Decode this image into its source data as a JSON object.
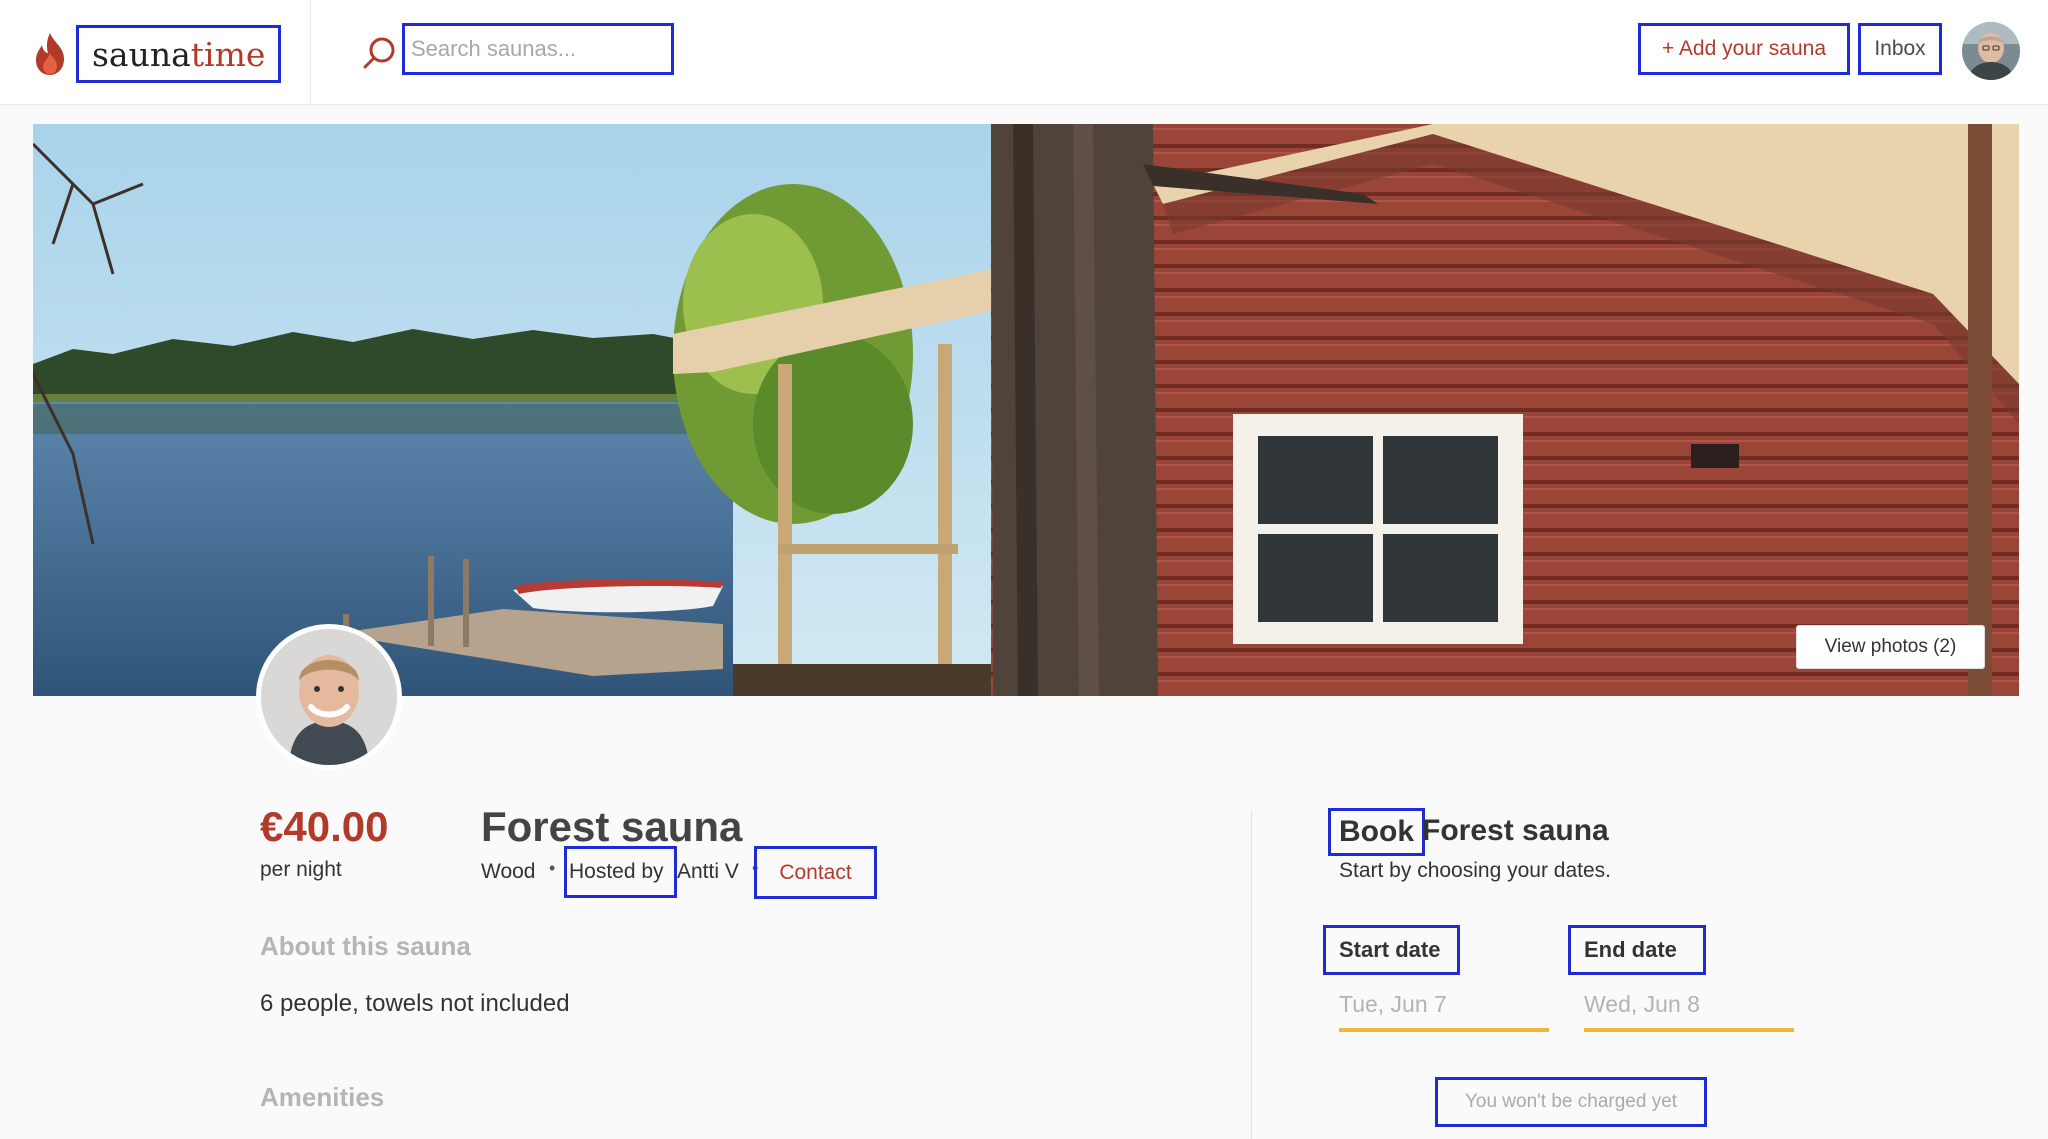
{
  "header": {
    "logo_part1": "sauna",
    "logo_part2": "time",
    "search_placeholder": "Search saunas...",
    "add_sauna_label": "+ Add your sauna",
    "inbox_label": "Inbox"
  },
  "hero": {
    "view_photos_label": "View photos (2)"
  },
  "listing": {
    "price": "€40.00",
    "per_night": "per night",
    "title": "Forest sauna",
    "type": "Wood",
    "hosted_by_label": "Hosted by",
    "host_name": "Antti V",
    "contact_label": "Contact",
    "about_heading": "About this sauna",
    "about_text": "6 people, towels not included",
    "amenities_heading": "Amenities"
  },
  "booking": {
    "book_label": "Book",
    "title": "Forest sauna",
    "subtitle": "Start by choosing your dates.",
    "start_label": "Start date",
    "start_placeholder": "Tue, Jun 7",
    "end_label": "End date",
    "end_placeholder": "Wed, Jun 8",
    "charge_note": "You won't be charged yet"
  },
  "colors": {
    "brand": "#b23a2a",
    "accent_underline": "#f2b63c",
    "annotation_box": "#1f2bd6"
  },
  "icons": [
    "flame-icon",
    "search-icon"
  ]
}
